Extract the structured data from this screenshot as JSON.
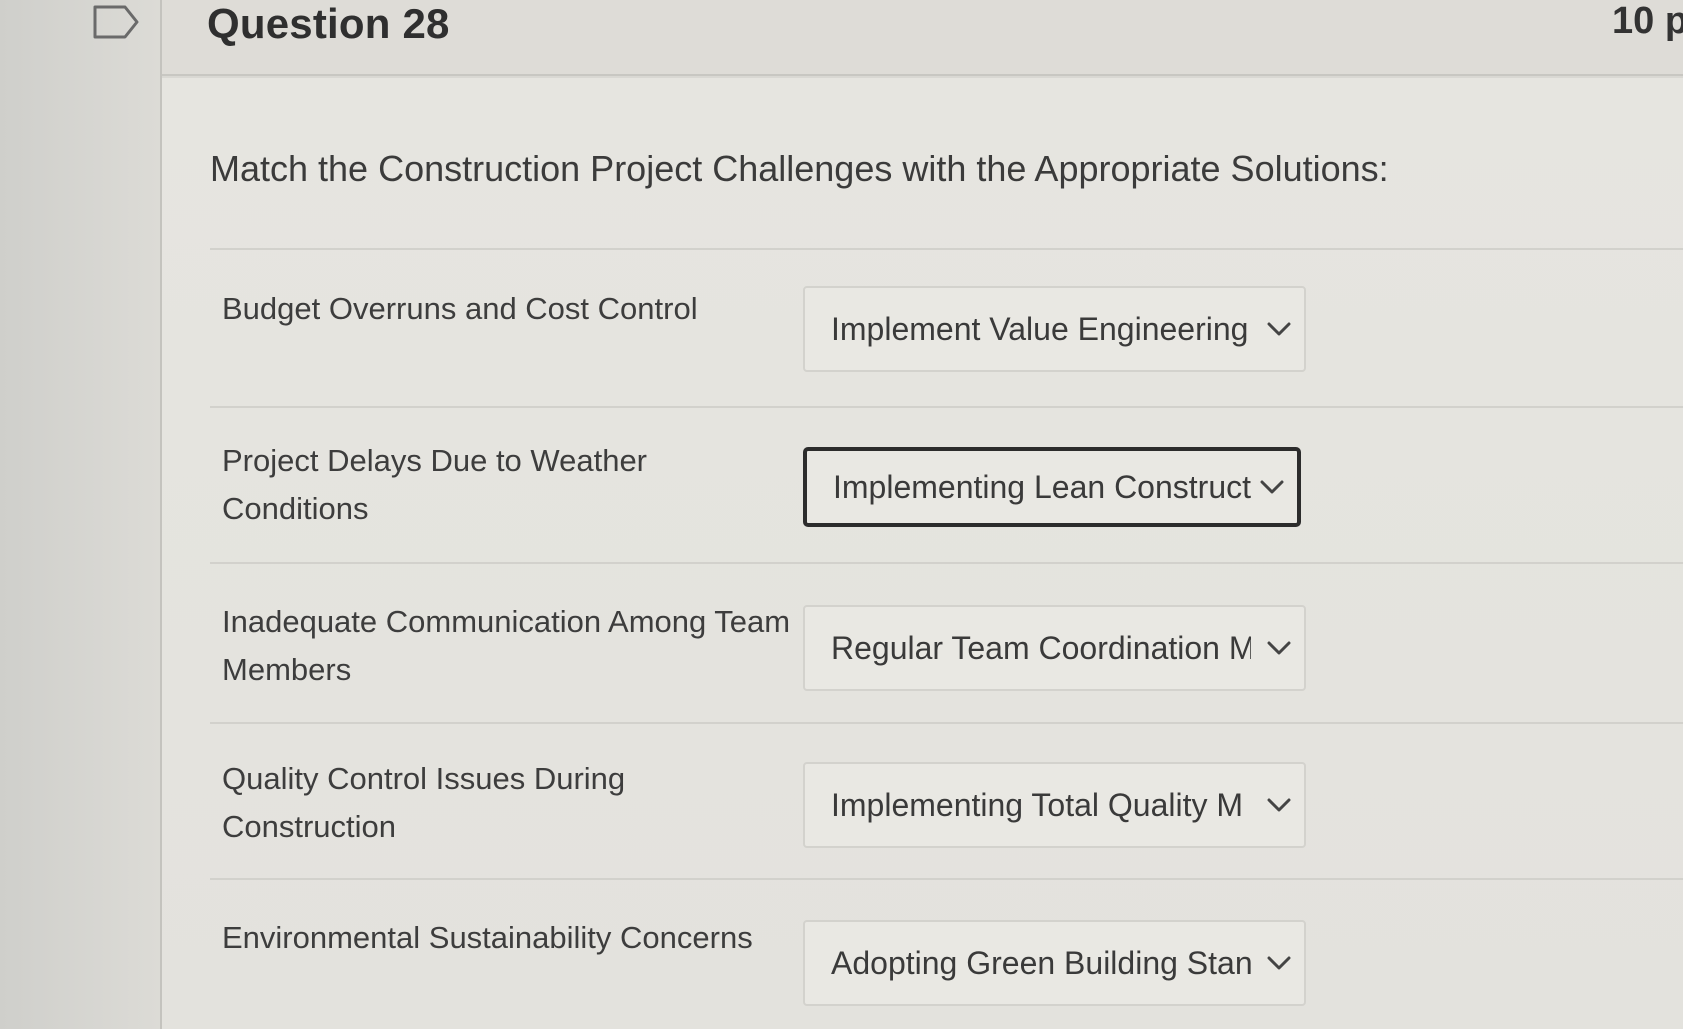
{
  "header": {
    "question_title": "Question 28",
    "points": "10 p"
  },
  "prompt": "Match the Construction Project Challenges with the Appropriate Solutions:",
  "rows": [
    {
      "label": "Budget Overruns and Cost Control",
      "selected": "Implement Value Engineering"
    },
    {
      "label": "Project Delays Due to Weather Conditions",
      "selected": "Implementing Lean Construct"
    },
    {
      "label": "Inadequate Communication Among Team Members",
      "selected": "Regular Team Coordination M"
    },
    {
      "label": "Quality Control Issues During Construction",
      "selected": "Implementing Total Quality M"
    },
    {
      "label": "Environmental Sustainability Concerns",
      "selected": "Adopting Green Building Stan"
    }
  ],
  "icons": {
    "flag": "flag-icon",
    "dropdown": "chevron-down-icon"
  }
}
